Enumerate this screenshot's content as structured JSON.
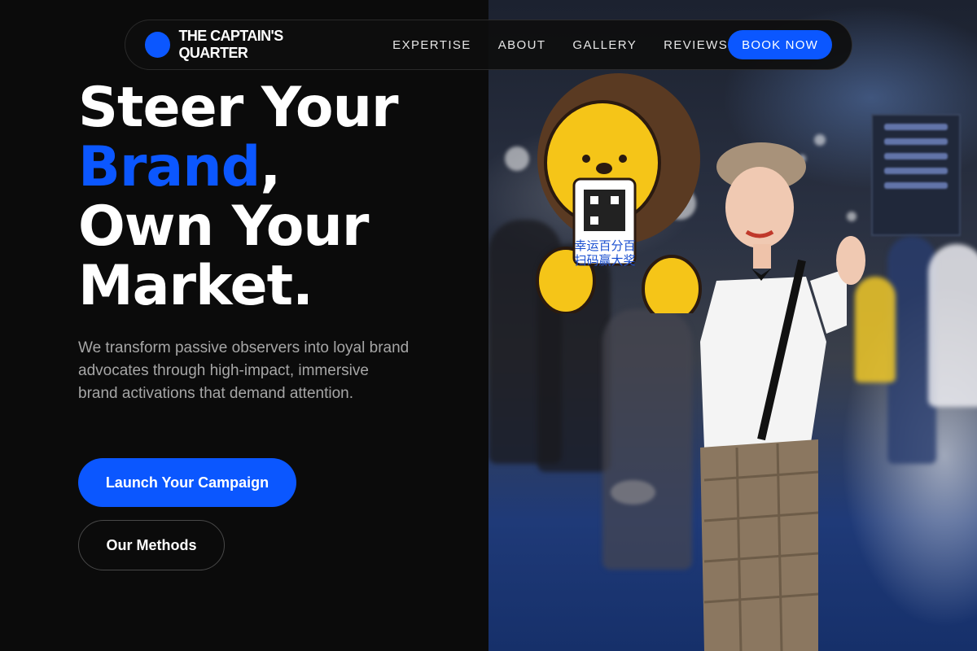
{
  "nav": {
    "brand_name": "THE CAPTAIN'S QUARTER",
    "links": [
      "EXPERTISE",
      "ABOUT",
      "GALLERY",
      "REVIEWS"
    ],
    "cta_label": "BOOK NOW"
  },
  "hero": {
    "title_line1": "Steer Your",
    "title_accent": "Brand",
    "title_comma": ",",
    "title_line3": "Own Your",
    "title_line4": "Market.",
    "description": "We transform passive observers into loyal brand advocates through high-impact, immersive brand activations that demand attention.",
    "primary_cta": "Launch Your Campaign",
    "secondary_cta": "Our Methods"
  },
  "photo": {
    "sign_text_line1": "幸运百分百",
    "sign_text_line2": "扫码赢大奖"
  },
  "colors": {
    "accent": "#0b57ff",
    "background": "#0b0b0b",
    "muted_text": "#a6a6a6"
  }
}
